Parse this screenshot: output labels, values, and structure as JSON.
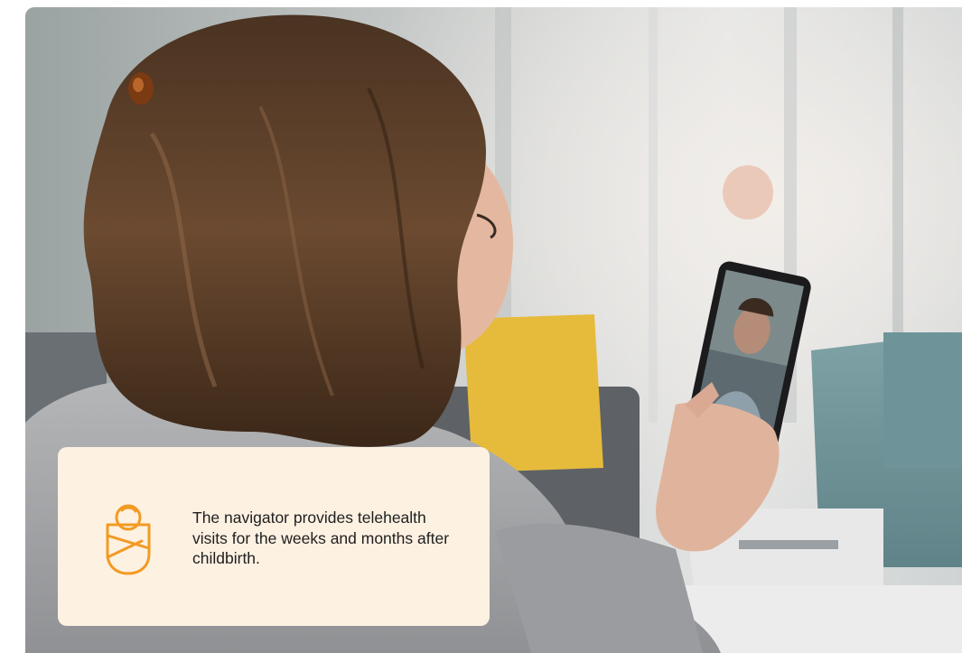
{
  "scene": {
    "icon_name": "swaddled-baby-icon",
    "accent_color": "#f39a22",
    "card_color": "#fdf1e2"
  },
  "caption": {
    "text": "The navigator provides telehealth visits for the weeks and months after childbirth."
  }
}
